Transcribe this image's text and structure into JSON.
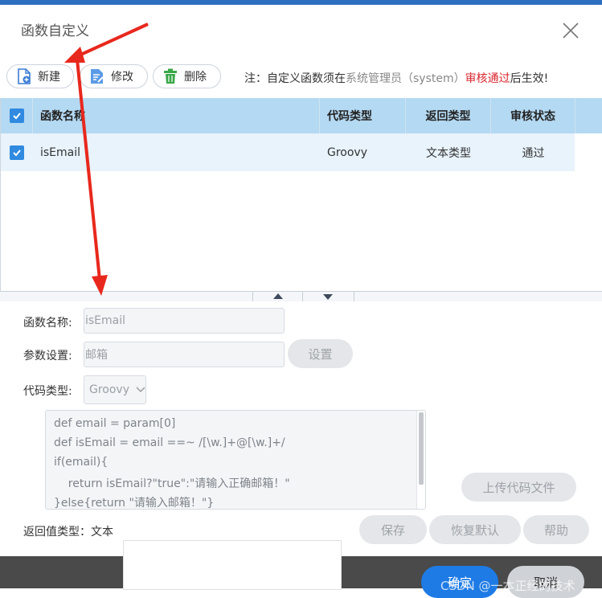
{
  "dialog": {
    "title": "函数自定义",
    "close_icon": "close-icon"
  },
  "toolbar": {
    "new_label": "新建",
    "edit_label": "修改",
    "delete_label": "删除",
    "note": {
      "prefix": "注：自定义函数须在",
      "admin": "系统管理员（system）",
      "approved": "审核通过",
      "suffix": "后生效!"
    }
  },
  "grid": {
    "columns": [
      "函数名称",
      "代码类型",
      "返回类型",
      "审核状态"
    ],
    "rows": [
      {
        "name": "isEmail",
        "code_type": "Groovy",
        "return_type": "文本类型",
        "status": "通过",
        "checked": true
      }
    ],
    "header_checked": true
  },
  "form": {
    "name_label": "函数名称:",
    "name_value": "isEmail",
    "params_label": "参数设置:",
    "params_value": "邮箱",
    "params_button": "设置",
    "code_type_label": "代码类型:",
    "code_type_value": "Groovy",
    "code_lines": [
      "def email = param[0]",
      "def isEmail = email ==~ /[\\w.]+@[\\w.]+/",
      "if(email){",
      "    return isEmail?\"true\":\"请输入正确邮箱！\"",
      "}else{return \"请输入邮箱！\"}"
    ],
    "upload_button": "上传代码文件",
    "return_label": "返回值类型：文本",
    "save_button": "保存",
    "restore_button": "恢复默认",
    "help_button": "帮助"
  },
  "footer": {
    "ok_button": "确定",
    "cancel_button": "取消",
    "watermark": "CSDN @一本正经的技术"
  },
  "colors": {
    "header_bg": "#b4d9f2",
    "row_bg": "#e8f3fc",
    "accent": "#1e7be5",
    "annotation_arrow": "#e8281d",
    "approved_text": "#d9272e"
  }
}
